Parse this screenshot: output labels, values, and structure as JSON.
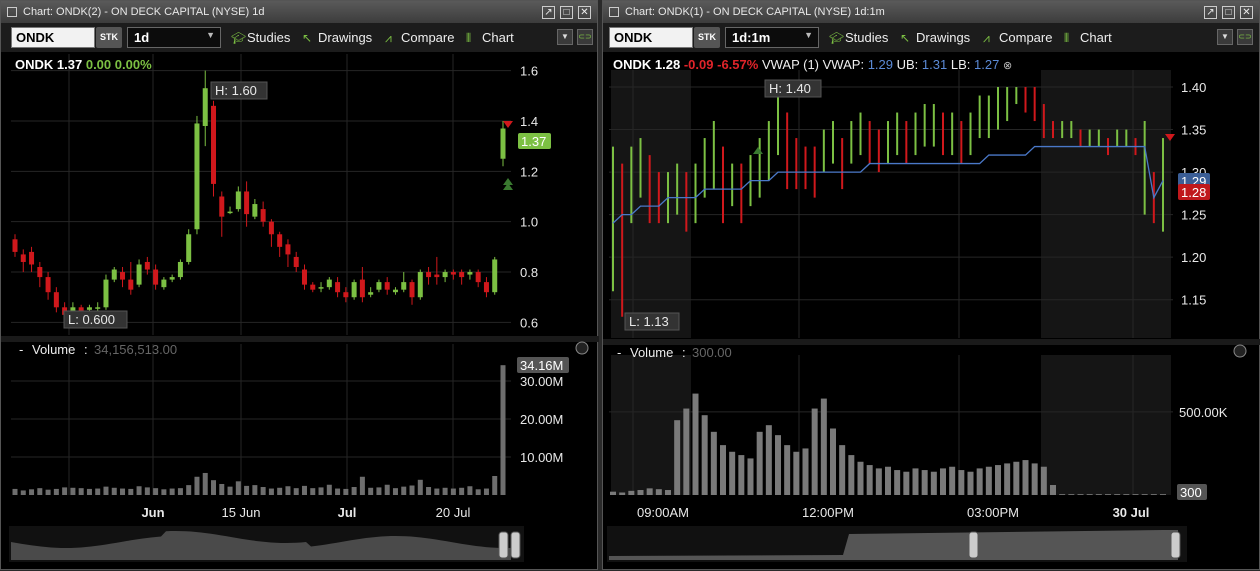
{
  "left": {
    "title": "Chart: ONDK(2) - ON DECK CAPITAL (NYSE) 1d",
    "symbol": "ONDK",
    "sec_type": "STK",
    "timeframe": "1d",
    "toolbar": {
      "studies": "Studies",
      "drawings": "Drawings",
      "compare": "Compare",
      "chart": "Chart"
    },
    "quote": {
      "symbol": "ONDK",
      "last": "1.37",
      "change": "0.00",
      "pct": "0.00%"
    },
    "price_labels": [
      "1.6",
      "1.4",
      "1.2",
      "1.0",
      "0.8",
      "0.6"
    ],
    "last_tag": "1.37",
    "high_label": "H: 1.60",
    "low_label": "L: 0.600",
    "volume": {
      "name": "Volume",
      "value": "34,156,513.00",
      "tag": "34.16M",
      "labels": [
        "30.00M",
        "20.00M",
        "10.00M"
      ]
    },
    "date_labels": [
      "Jun",
      "15 Jun",
      "Jul",
      "20 Jul"
    ]
  },
  "right": {
    "title": "Chart: ONDK(1) - ON DECK CAPITAL (NYSE) 1d:1m",
    "symbol": "ONDK",
    "sec_type": "STK",
    "timeframe": "1d:1m",
    "toolbar": {
      "studies": "Studies",
      "drawings": "Drawings",
      "compare": "Compare",
      "chart": "Chart"
    },
    "quote": {
      "symbol": "ONDK",
      "last": "1.28",
      "change": "-0.09",
      "pct": "-6.57%",
      "vwap_name": "VWAP (1)",
      "vwap_label": "VWAP:",
      "vwap": "1.29",
      "ub_label": "UB:",
      "ub": "1.31",
      "lb_label": "LB:",
      "lb": "1.27"
    },
    "price_labels": [
      "1.40",
      "1.35",
      "1.30",
      "1.25",
      "1.20",
      "1.15"
    ],
    "vwap_tag": "1.29",
    "last_tag": "1.28",
    "high_label": "H: 1.40",
    "low_label": "L: 1.13",
    "volume": {
      "name": "Volume",
      "value": "300.00",
      "tag": "300",
      "labels": [
        "500.00K"
      ]
    },
    "time_labels": [
      "09:00AM",
      "12:00PM",
      "03:00PM",
      "30 Jul"
    ]
  },
  "colors": {
    "up": "#7cc043",
    "down": "#d0181c",
    "vwap": "#4a78c8",
    "grid": "#262626"
  },
  "chart_data": [
    {
      "type": "candlestick",
      "title": "ONDK 1d",
      "candles": [
        [
          0.93,
          0.88,
          0.86,
          0.95
        ],
        [
          0.87,
          0.84,
          0.8,
          0.89
        ],
        [
          0.88,
          0.83,
          0.8,
          0.9
        ],
        [
          0.82,
          0.78,
          0.74,
          0.84
        ],
        [
          0.78,
          0.72,
          0.69,
          0.8
        ],
        [
          0.72,
          0.66,
          0.64,
          0.74
        ],
        [
          0.66,
          0.63,
          0.6,
          0.68
        ],
        [
          0.63,
          0.66,
          0.62,
          0.68
        ],
        [
          0.66,
          0.64,
          0.62,
          0.67
        ],
        [
          0.65,
          0.66,
          0.63,
          0.67
        ],
        [
          0.66,
          0.66,
          0.64,
          0.68
        ],
        [
          0.66,
          0.77,
          0.65,
          0.79
        ],
        [
          0.77,
          0.81,
          0.76,
          0.82
        ],
        [
          0.8,
          0.77,
          0.74,
          0.82
        ],
        [
          0.77,
          0.73,
          0.71,
          0.84
        ],
        [
          0.75,
          0.83,
          0.74,
          0.85
        ],
        [
          0.84,
          0.81,
          0.79,
          0.86
        ],
        [
          0.81,
          0.75,
          0.73,
          0.83
        ],
        [
          0.74,
          0.77,
          0.73,
          0.78
        ],
        [
          0.77,
          0.78,
          0.76,
          0.79
        ],
        [
          0.78,
          0.84,
          0.77,
          0.85
        ],
        [
          0.84,
          0.95,
          0.83,
          0.97
        ],
        [
          0.97,
          1.39,
          0.95,
          1.42
        ],
        [
          1.38,
          1.53,
          1.3,
          1.6
        ],
        [
          1.46,
          1.15,
          1.1,
          1.48
        ],
        [
          1.1,
          1.02,
          0.94,
          1.12
        ],
        [
          1.04,
          1.04,
          1.03,
          1.06
        ],
        [
          1.05,
          1.12,
          1.04,
          1.14
        ],
        [
          1.12,
          1.03,
          0.98,
          1.16
        ],
        [
          1.02,
          1.07,
          1.01,
          1.09
        ],
        [
          1.05,
          1.0,
          0.98,
          1.08
        ],
        [
          1.0,
          0.95,
          0.9,
          1.01
        ],
        [
          0.95,
          0.9,
          0.86,
          0.96
        ],
        [
          0.91,
          0.87,
          0.82,
          0.93
        ],
        [
          0.86,
          0.82,
          0.8,
          0.88
        ],
        [
          0.81,
          0.75,
          0.73,
          0.83
        ],
        [
          0.75,
          0.73,
          0.72,
          0.76
        ],
        [
          0.74,
          0.74,
          0.72,
          0.76
        ],
        [
          0.74,
          0.77,
          0.73,
          0.78
        ],
        [
          0.76,
          0.72,
          0.7,
          0.78
        ],
        [
          0.72,
          0.7,
          0.68,
          0.74
        ],
        [
          0.7,
          0.76,
          0.69,
          0.77
        ],
        [
          0.77,
          0.7,
          0.68,
          0.82
        ],
        [
          0.71,
          0.72,
          0.7,
          0.74
        ],
        [
          0.73,
          0.76,
          0.72,
          0.77
        ],
        [
          0.76,
          0.73,
          0.71,
          0.78
        ],
        [
          0.72,
          0.73,
          0.71,
          0.74
        ],
        [
          0.73,
          0.76,
          0.72,
          0.8
        ],
        [
          0.76,
          0.7,
          0.67,
          0.77
        ],
        [
          0.7,
          0.8,
          0.69,
          0.81
        ],
        [
          0.8,
          0.78,
          0.75,
          0.82
        ],
        [
          0.79,
          0.78,
          0.75,
          0.86
        ],
        [
          0.78,
          0.8,
          0.76,
          0.81
        ],
        [
          0.8,
          0.79,
          0.77,
          0.81
        ],
        [
          0.8,
          0.78,
          0.75,
          0.81
        ],
        [
          0.79,
          0.8,
          0.77,
          0.81
        ],
        [
          0.8,
          0.76,
          0.74,
          0.81
        ],
        [
          0.76,
          0.72,
          0.7,
          0.78
        ],
        [
          0.72,
          0.85,
          0.71,
          0.86
        ],
        [
          1.25,
          1.37,
          1.22,
          1.4
        ]
      ],
      "volume_millions": [
        1.6,
        1.2,
        1.5,
        1.8,
        1.4,
        1.6,
        2.0,
        1.9,
        1.8,
        1.6,
        1.7,
        2.2,
        1.9,
        1.7,
        1.6,
        2.3,
        2.0,
        1.8,
        1.5,
        1.7,
        1.8,
        2.6,
        4.8,
        5.8,
        3.9,
        2.9,
        2.2,
        3.6,
        2.4,
        2.6,
        2.1,
        1.7,
        1.9,
        2.3,
        1.8,
        2.4,
        1.8,
        2.0,
        2.7,
        1.7,
        1.6,
        2.1,
        4.8,
        1.9,
        2.0,
        2.7,
        1.8,
        2.2,
        2.5,
        4.0,
        2.1,
        1.7,
        1.9,
        1.7,
        1.9,
        2.3,
        1.5,
        1.7,
        5.0,
        34.16
      ],
      "ylim": [
        0.55,
        1.65
      ],
      "volume_ylim": [
        0,
        35
      ]
    },
    {
      "type": "line",
      "title": "ONDK 1d:1m",
      "close": [
        1.3,
        1.25,
        1.3,
        1.31,
        1.28,
        1.27,
        1.27,
        1.28,
        1.25,
        1.26,
        1.3,
        1.31,
        1.27,
        1.28,
        1.25,
        1.28,
        1.29,
        1.31,
        1.37,
        1.33,
        1.31,
        1.3,
        1.29,
        1.32,
        1.33,
        1.3,
        1.33,
        1.34,
        1.33,
        1.32,
        1.33,
        1.34,
        1.33,
        1.34,
        1.35,
        1.35,
        1.34,
        1.34,
        1.33,
        1.34,
        1.36,
        1.36,
        1.37,
        1.38,
        1.4,
        1.39,
        1.38,
        1.36,
        1.35,
        1.35,
        1.35,
        1.34,
        1.34,
        1.34,
        1.33,
        1.34,
        1.34,
        1.33,
        1.34,
        1.26,
        1.28
      ],
      "high": [
        1.33,
        1.31,
        1.33,
        1.34,
        1.32,
        1.3,
        1.3,
        1.31,
        1.3,
        1.31,
        1.34,
        1.36,
        1.33,
        1.31,
        1.31,
        1.32,
        1.34,
        1.36,
        1.4,
        1.37,
        1.34,
        1.33,
        1.33,
        1.35,
        1.36,
        1.34,
        1.36,
        1.37,
        1.36,
        1.35,
        1.36,
        1.37,
        1.36,
        1.37,
        1.38,
        1.38,
        1.37,
        1.37,
        1.36,
        1.37,
        1.39,
        1.39,
        1.4,
        1.4,
        1.4,
        1.4,
        1.4,
        1.38,
        1.36,
        1.36,
        1.36,
        1.35,
        1.35,
        1.35,
        1.34,
        1.35,
        1.35,
        1.34,
        1.36,
        1.3,
        1.34
      ],
      "low": [
        1.16,
        1.13,
        1.24,
        1.27,
        1.24,
        1.24,
        1.24,
        1.25,
        1.23,
        1.24,
        1.27,
        1.28,
        1.24,
        1.26,
        1.24,
        1.26,
        1.27,
        1.29,
        1.32,
        1.28,
        1.28,
        1.28,
        1.27,
        1.3,
        1.31,
        1.28,
        1.31,
        1.32,
        1.31,
        1.3,
        1.31,
        1.32,
        1.31,
        1.32,
        1.33,
        1.33,
        1.32,
        1.32,
        1.31,
        1.32,
        1.34,
        1.34,
        1.35,
        1.36,
        1.38,
        1.37,
        1.36,
        1.34,
        1.34,
        1.34,
        1.34,
        1.33,
        1.33,
        1.33,
        1.32,
        1.33,
        1.33,
        1.32,
        1.25,
        1.24,
        1.23
      ],
      "vwap": [
        1.24,
        1.25,
        1.25,
        1.26,
        1.26,
        1.26,
        1.27,
        1.27,
        1.27,
        1.27,
        1.28,
        1.28,
        1.28,
        1.28,
        1.28,
        1.29,
        1.29,
        1.29,
        1.3,
        1.3,
        1.3,
        1.3,
        1.3,
        1.3,
        1.3,
        1.3,
        1.3,
        1.3,
        1.31,
        1.31,
        1.31,
        1.31,
        1.31,
        1.31,
        1.31,
        1.31,
        1.31,
        1.31,
        1.31,
        1.31,
        1.31,
        1.32,
        1.32,
        1.32,
        1.32,
        1.32,
        1.33,
        1.33,
        1.33,
        1.33,
        1.33,
        1.33,
        1.33,
        1.33,
        1.33,
        1.33,
        1.33,
        1.33,
        1.33,
        1.27,
        1.29
      ],
      "volume_thousands": [
        20,
        15,
        25,
        30,
        40,
        35,
        30,
        450,
        520,
        610,
        480,
        380,
        300,
        260,
        240,
        220,
        380,
        420,
        360,
        300,
        260,
        280,
        520,
        580,
        400,
        300,
        240,
        200,
        180,
        160,
        170,
        150,
        140,
        160,
        150,
        140,
        160,
        170,
        150,
        140,
        160,
        170,
        180,
        190,
        200,
        210,
        190,
        170,
        60,
        5,
        5,
        5,
        5,
        5,
        5,
        5,
        5,
        5,
        5,
        5,
        5
      ],
      "ylim": [
        1.105,
        1.42
      ],
      "volume_ylim": [
        0,
        800
      ]
    }
  ]
}
